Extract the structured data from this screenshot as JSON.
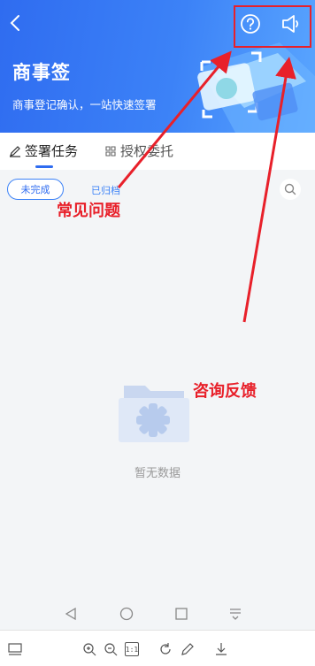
{
  "header": {
    "title": "商事签",
    "subtitle": "商事登记确认，一站快速签署",
    "back_icon": "chevron-left-icon",
    "help_icon": "question-circle-icon",
    "feedback_icon": "speaker-icon"
  },
  "tabs": [
    {
      "label": "签署任务",
      "icon": "pen-icon",
      "active": true
    },
    {
      "label": "授权委托",
      "icon": "document-grid-icon",
      "active": false
    }
  ],
  "filters": [
    {
      "label": "未完成",
      "active": true
    },
    {
      "label": "已归档",
      "active": false
    }
  ],
  "search_icon": "search-icon",
  "empty_state": {
    "text": "暂无数据",
    "icon": "empty-folder-icon"
  },
  "annotations": {
    "faq": "常见问题",
    "feedback": "咨询反馈"
  },
  "colors": {
    "primary": "#2f6cf0",
    "annotation": "#e8202a",
    "background": "#f3f5f7"
  },
  "system_nav": [
    "back-triangle-icon",
    "home-circle-icon",
    "recent-square-icon",
    "menu-down-icon"
  ],
  "viewer_toolbar": [
    "screen-icon",
    "zoom-in-icon",
    "zoom-out-icon",
    "actual-size-icon",
    "rotate-icon",
    "edit-pen-icon",
    "download-icon"
  ],
  "viewer_toolbar_text": {
    "actual_size": "1:1"
  }
}
